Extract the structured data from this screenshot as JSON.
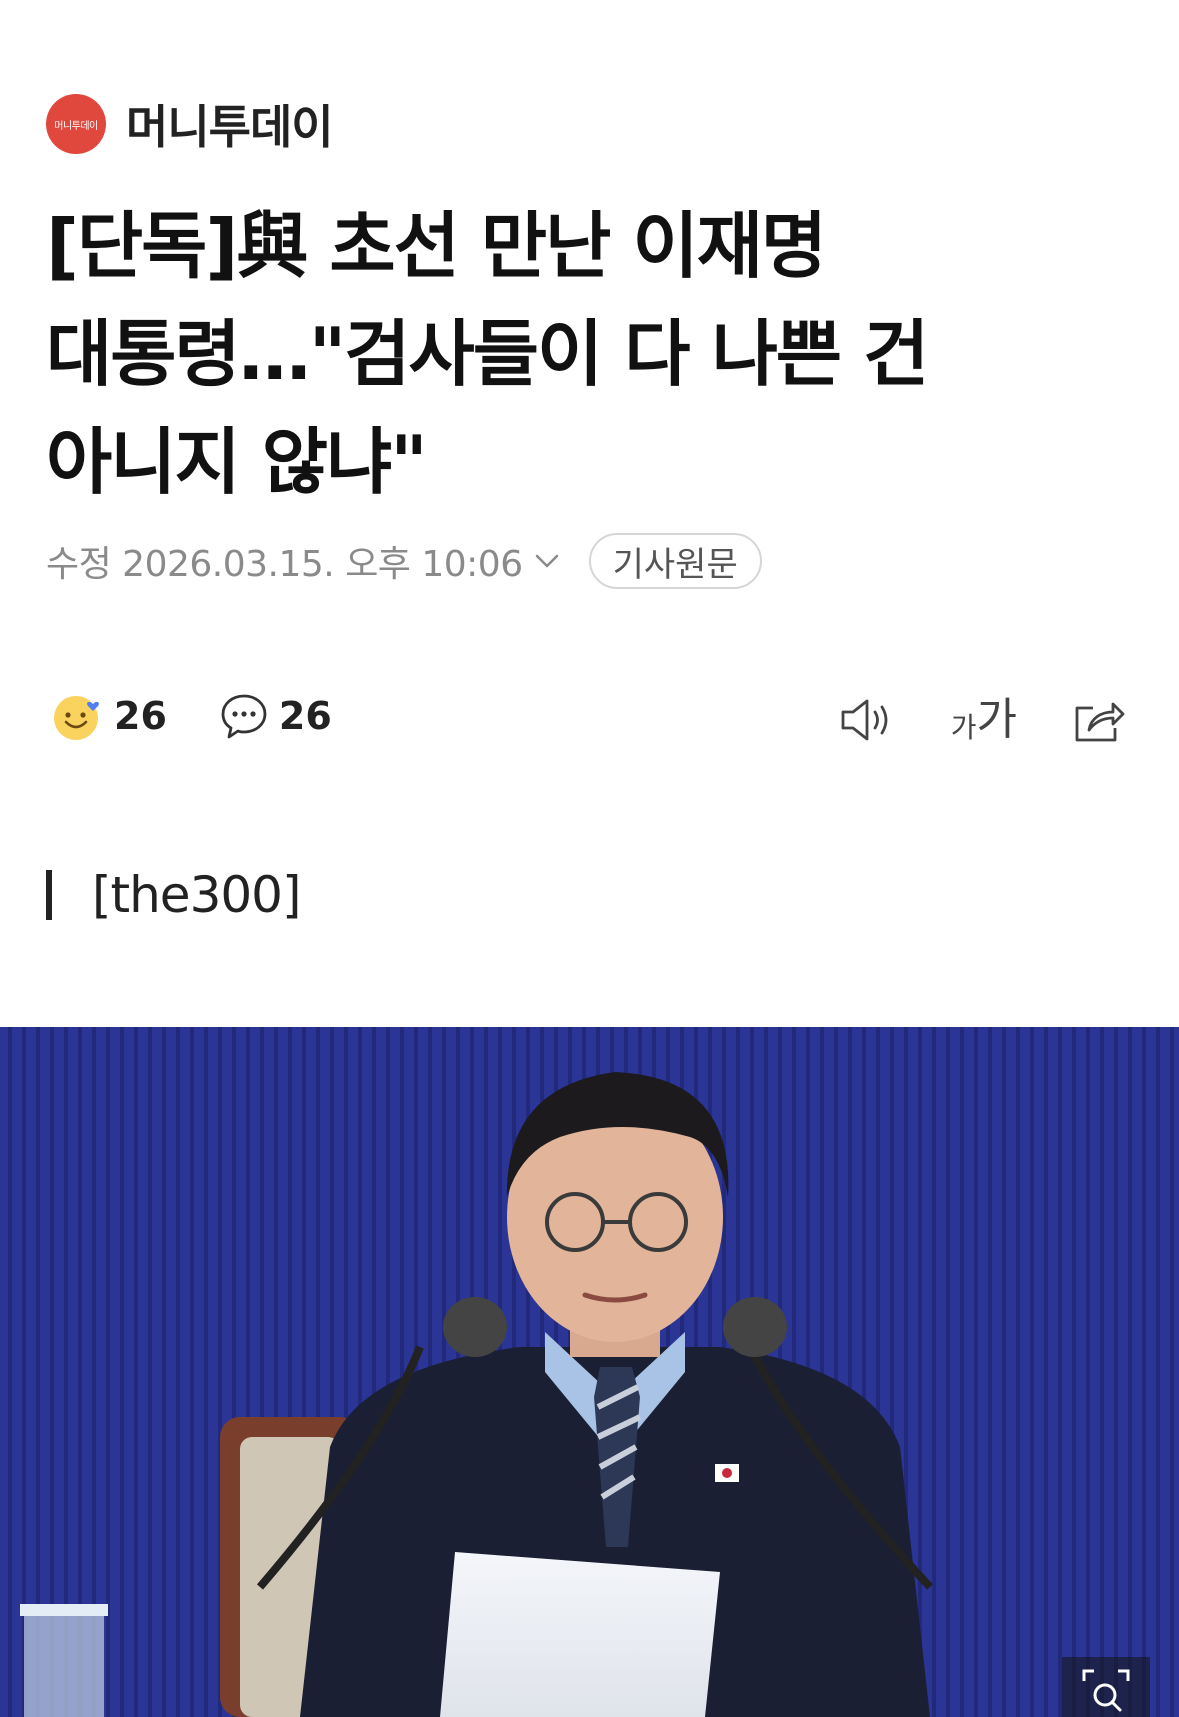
{
  "publisher": {
    "logo_text": "머니투데이",
    "name": "머니투데이",
    "logo_color": "#e0483e"
  },
  "article": {
    "title": "[단독]與 초선 만난 이재명 대통령…\"검사들이 다 나쁜 건 아니지 않냐\"",
    "date": "수정 2026.03.15. 오후 10:06",
    "original_button": "기사원문",
    "subheading": "[the300]"
  },
  "actions": {
    "reactions_count": "26",
    "comments_count": "26"
  },
  "tools": {
    "font_small": "가",
    "font_large": "가"
  },
  "icons": [
    "smile-reaction-icon",
    "comment-icon",
    "chevron-down-icon",
    "speaker-icon",
    "share-icon",
    "zoom-icon"
  ],
  "photo": {
    "background_color": "#2b3596"
  }
}
